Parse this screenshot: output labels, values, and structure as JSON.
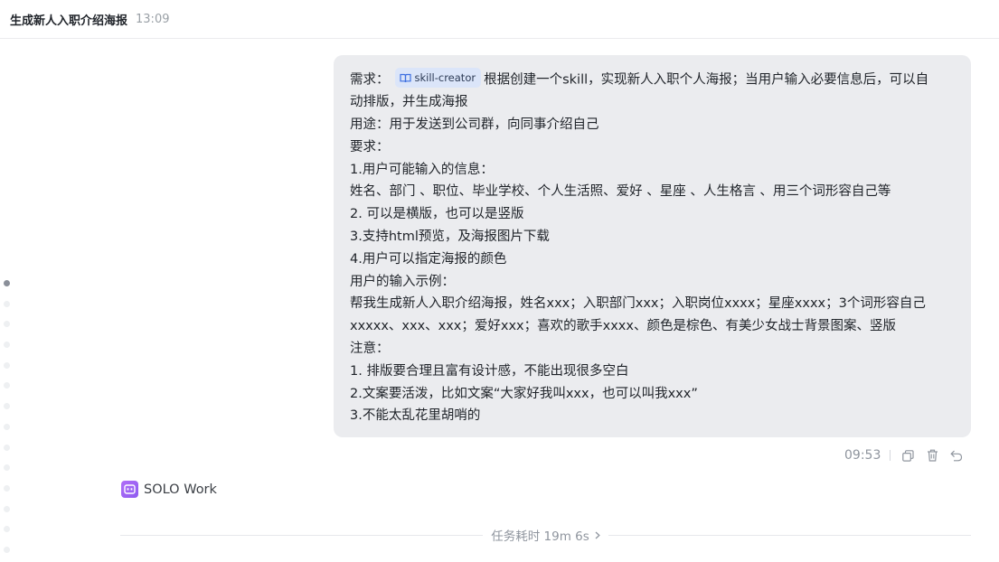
{
  "header": {
    "title": "生成新人入职介绍海报",
    "time": "13:09"
  },
  "message": {
    "chip": {
      "label": "skill-creator",
      "icon": "book-icon"
    },
    "lines": [
      {
        "pre": "需求：",
        "post": "根据创建一个skill，实现新人入职个人海报；当用户输入必要信息后，可以自"
      },
      {
        "text": "动排版，并生成海报"
      },
      {
        "text": "用途：用于发送到公司群，向同事介绍自己"
      },
      {
        "text": "要求："
      },
      {
        "text": "1.用户可能输入的信息："
      },
      {
        "text": "姓名、部门 、职位、毕业学校、个人生活照、爱好 、星座 、人生格言 、用三个词形容自己等"
      },
      {
        "text": "2. 可以是横版，也可以是竖版"
      },
      {
        "text": "3.支持html预览，及海报图片下载"
      },
      {
        "text": "4.用户可以指定海报的颜色"
      },
      {
        "text": "用户的输入示例："
      },
      {
        "text": "帮我生成新人入职介绍海报，姓名xxx；入职部门xxx；入职岗位xxxx；星座xxxx；3个词形容自己"
      },
      {
        "text": "xxxxx、xxx、xxx；爱好xxx；喜欢的歌手xxxx、颜色是棕色、有美少女战士背景图案、竖版"
      },
      {
        "text": "注意："
      },
      {
        "text": "1. 排版要合理且富有设计感，不能出现很多空白"
      },
      {
        "text": "2.文案要活泼，比如文案“大家好我叫xxx，也可以叫我xxx”"
      },
      {
        "text": "3.不能太乱花里胡哨的"
      }
    ],
    "time": "09:53",
    "actions": [
      "copy-icon",
      "delete-icon",
      "undo-icon"
    ]
  },
  "agent": {
    "name": "SOLO Work",
    "icon": "robot-icon"
  },
  "footer": {
    "label": "任务耗时 19m 6s",
    "icon": "chevron-right-icon"
  },
  "colors": {
    "bubble": "#ebecef",
    "chip": "#dbe5f9",
    "agent_logo": "#a066f5"
  }
}
